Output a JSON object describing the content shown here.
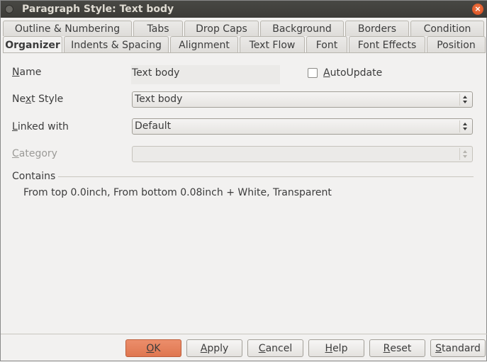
{
  "window": {
    "title": "Paragraph Style: Text body"
  },
  "tabs_row1": [
    "Outline & Numbering",
    "Tabs",
    "Drop Caps",
    "Background",
    "Borders",
    "Condition"
  ],
  "tabs_row2": [
    "Organizer",
    "Indents & Spacing",
    "Alignment",
    "Text Flow",
    "Font",
    "Font Effects",
    "Position"
  ],
  "active_tab": "Organizer",
  "form": {
    "name_label_pre": "",
    "name_label_ul": "N",
    "name_label_post": "ame",
    "name_value": "Text body",
    "autoupdate_pre": "",
    "autoupdate_ul": "A",
    "autoupdate_post": "utoUpdate",
    "autoupdate_checked": false,
    "next_label_pre": "Ne",
    "next_label_ul": "x",
    "next_label_post": "t Style",
    "next_value": "Text body",
    "linked_label_pre": "",
    "linked_label_ul": "L",
    "linked_label_post": "inked with",
    "linked_value": "Default",
    "category_label_pre": "",
    "category_label_ul": "C",
    "category_label_post": "ategory",
    "category_value": ""
  },
  "contains": {
    "title": "Contains",
    "text": "From top 0.0inch, From bottom 0.08inch + White, Transparent"
  },
  "buttons": [
    {
      "pre": "",
      "ul": "O",
      "post": "K"
    },
    {
      "pre": "",
      "ul": "A",
      "post": "pply"
    },
    {
      "pre": "",
      "ul": "C",
      "post": "ancel"
    },
    {
      "pre": "",
      "ul": "H",
      "post": "elp"
    },
    {
      "pre": "",
      "ul": "R",
      "post": "eset"
    },
    {
      "pre": "",
      "ul": "S",
      "post": "tandard"
    }
  ],
  "colors": {
    "accent": "#df7650",
    "titlebar": "#3c3b37"
  }
}
